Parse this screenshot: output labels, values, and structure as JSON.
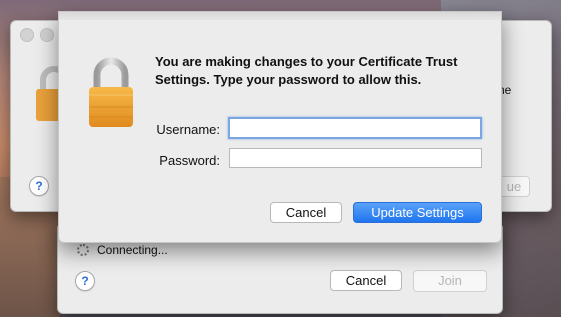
{
  "auth_sheet": {
    "message": "You are making changes to your Certificate Trust Settings. Type your password to allow this.",
    "username_label": "Username:",
    "username_value": "",
    "password_label": "Password:",
    "password_value": "",
    "cancel_label": "Cancel",
    "confirm_label": "Update Settings"
  },
  "back_window": {
    "partial_text": "he",
    "partial_button": "ue"
  },
  "connect_window": {
    "status_text": "Connecting...",
    "cancel_label": "Cancel",
    "join_label": "Join"
  },
  "help_glyph": "?",
  "colors": {
    "accent": "#1f75ef",
    "lock_body": "#f0a334",
    "window_bg": "#ececec"
  }
}
